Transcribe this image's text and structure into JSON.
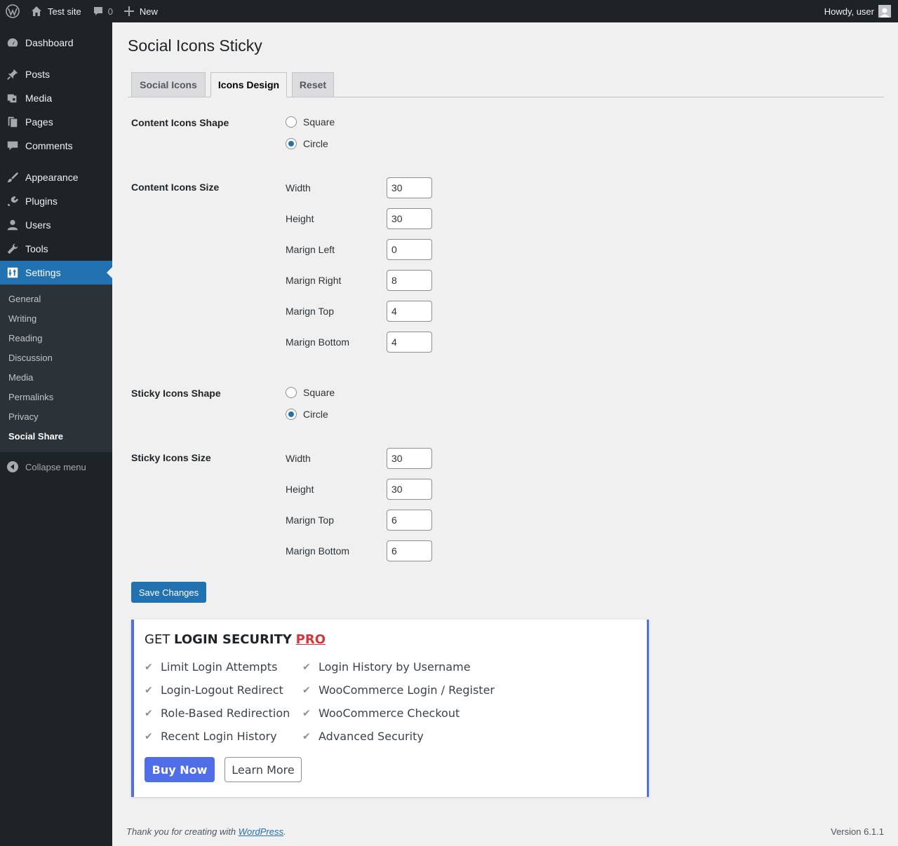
{
  "adminbar": {
    "site_name": "Test site",
    "comments_count": "0",
    "new_label": "New",
    "howdy": "Howdy, user"
  },
  "sidebar": {
    "items": [
      {
        "label": "Dashboard",
        "icon": "dashboard-icon"
      },
      {
        "label": "Posts",
        "icon": "pin-icon"
      },
      {
        "label": "Media",
        "icon": "media-icon"
      },
      {
        "label": "Pages",
        "icon": "pages-icon"
      },
      {
        "label": "Comments",
        "icon": "comment-icon"
      },
      {
        "label": "Appearance",
        "icon": "paintbrush-icon"
      },
      {
        "label": "Plugins",
        "icon": "plugin-icon"
      },
      {
        "label": "Users",
        "icon": "user-icon"
      },
      {
        "label": "Tools",
        "icon": "wrench-icon"
      },
      {
        "label": "Settings",
        "icon": "settings-icon"
      }
    ],
    "submenu": [
      "General",
      "Writing",
      "Reading",
      "Discussion",
      "Media",
      "Permalinks",
      "Privacy",
      "Social Share"
    ],
    "collapse": "Collapse menu"
  },
  "page": {
    "title": "Social Icons Sticky",
    "tabs": [
      "Social Icons",
      "Icons Design",
      "Reset"
    ],
    "active_tab": "Icons Design"
  },
  "form": {
    "content_shape": {
      "label": "Content Icons Shape",
      "options": [
        "Square",
        "Circle"
      ],
      "selected": "Circle"
    },
    "content_size": {
      "label": "Content Icons Size",
      "fields": [
        {
          "label": "Width",
          "value": "30"
        },
        {
          "label": "Height",
          "value": "30"
        },
        {
          "label": "Marign Left",
          "value": "0"
        },
        {
          "label": "Marign Right",
          "value": "8"
        },
        {
          "label": "Marign Top",
          "value": "4"
        },
        {
          "label": "Marign Bottom",
          "value": "4"
        }
      ]
    },
    "sticky_shape": {
      "label": "Sticky Icons Shape",
      "options": [
        "Square",
        "Circle"
      ],
      "selected": "Circle"
    },
    "sticky_size": {
      "label": "Sticky Icons Size",
      "fields": [
        {
          "label": "Width",
          "value": "30"
        },
        {
          "label": "Height",
          "value": "30"
        },
        {
          "label": "Marign Top",
          "value": "6"
        },
        {
          "label": "Marign Bottom",
          "value": "6"
        }
      ]
    },
    "save_label": "Save Changes"
  },
  "promo": {
    "title_prefix": "GET ",
    "title_bold": "LOGIN SECURITY",
    "title_pro": "PRO",
    "features_left": [
      "Limit Login Attempts",
      "Login-Logout Redirect",
      "Role-Based Redirection",
      "Recent Login History"
    ],
    "features_right": [
      "Login History by Username",
      "WooCommerce Login / Register",
      "WooCommerce Checkout",
      "Advanced Security"
    ],
    "buy_label": "Buy Now",
    "learn_label": "Learn More"
  },
  "footer": {
    "thanks_prefix": "Thank you for creating with ",
    "thanks_link": "WordPress",
    "thanks_suffix": ".",
    "version": "Version 6.1.1"
  }
}
